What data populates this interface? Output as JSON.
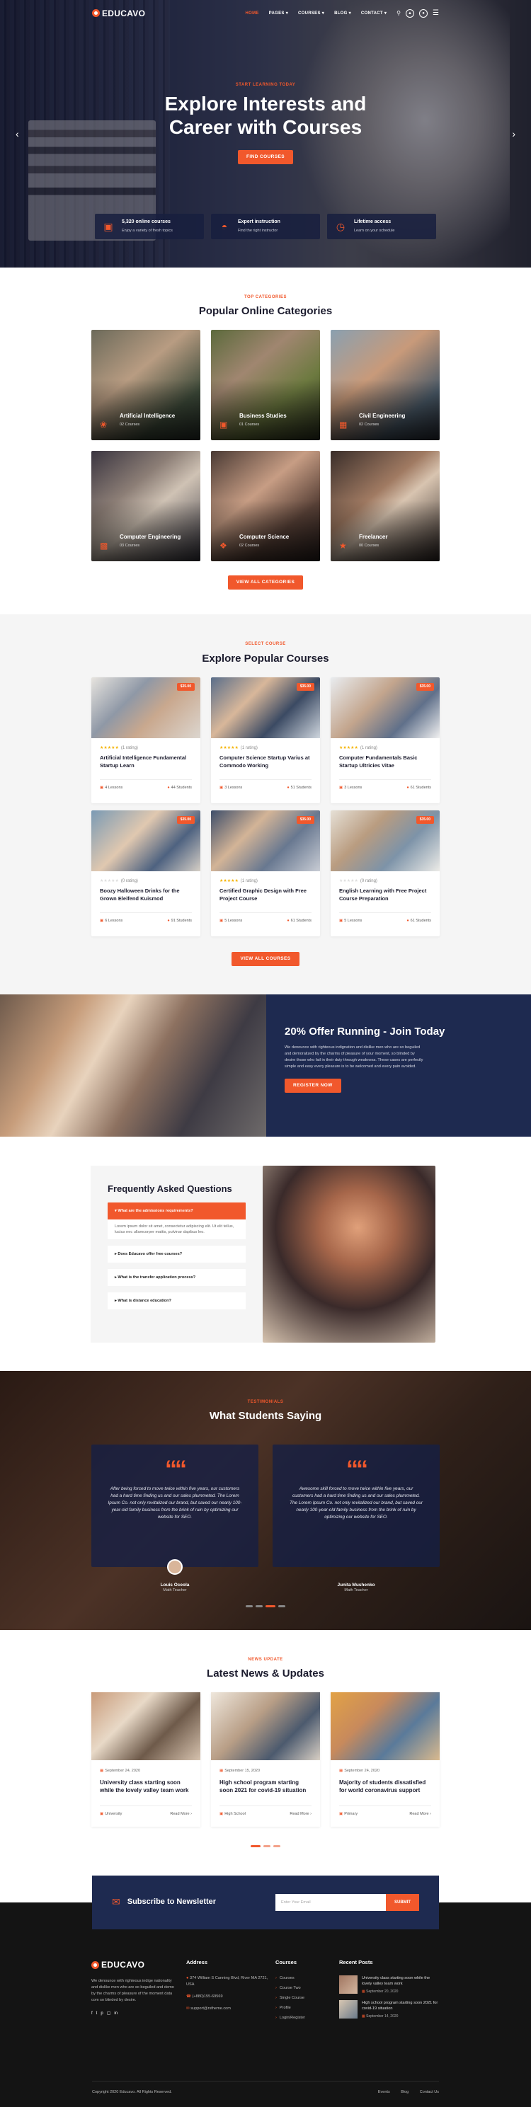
{
  "nav": {
    "brand": "EDUCAVO",
    "menu": [
      "HOME",
      "PAGES",
      "COURSES",
      "BLOG",
      "CONTACT"
    ],
    "active": "HOME"
  },
  "hero": {
    "kicker": "START LEARNING TODAY",
    "title_line1": "Explore Interests and",
    "title_line2": "Career with Courses",
    "button": "FIND COURSES",
    "features": [
      {
        "title": "5,320 online courses",
        "text": "Enjoy a variety of fresh topics",
        "icon": "monitor-icon"
      },
      {
        "title": "Expert instruction",
        "text": "Find the right instructor",
        "icon": "instructor-icon"
      },
      {
        "title": "Lifetime access",
        "text": "Learn on your schedule",
        "icon": "clock-icon"
      }
    ]
  },
  "categories": {
    "kicker": "TOP CATEGORIES",
    "title": "Popular Online Categories",
    "items": [
      {
        "name": "Artificial Intelligence",
        "count": "02 Courses"
      },
      {
        "name": "Business Studies",
        "count": "01 Courses"
      },
      {
        "name": "Civil Engineering",
        "count": "02 Courses"
      },
      {
        "name": "Computer Engineering",
        "count": "03 Courses"
      },
      {
        "name": "Computer Science",
        "count": "02 Courses"
      },
      {
        "name": "Freelancer",
        "count": "00 Courses"
      }
    ],
    "button": "VIEW ALL CATEGORIES"
  },
  "courses": {
    "kicker": "SELECT COURSE",
    "title": "Explore Popular Courses",
    "items": [
      {
        "title": "Artificial Intelligence Fundamental Startup Learn",
        "rating": "(1 rating)",
        "lessons": "4 Lessons",
        "students": "44 Students",
        "price": "$35.00",
        "stars": 5
      },
      {
        "title": "Computer Science Startup Varius at Commodo Working",
        "rating": "(1 rating)",
        "lessons": "3 Lessons",
        "students": "51 Students",
        "price": "$35.00",
        "stars": 5
      },
      {
        "title": "Computer Fundamentals Basic Startup Ultricies Vitae",
        "rating": "(1 rating)",
        "lessons": "3 Lessons",
        "students": "61 Students",
        "price": "$35.00",
        "stars": 5
      },
      {
        "title": "Boozy Halloween Drinks for the Grown Eleifend Kuismod",
        "rating": "(0 rating)",
        "lessons": "6 Lessons",
        "students": "91 Students",
        "price": "$35.00",
        "stars": 0
      },
      {
        "title": "Certified Graphic Design with Free Project Course",
        "rating": "(1 rating)",
        "lessons": "5 Lessons",
        "students": "61 Students",
        "price": "$35.00",
        "stars": 5
      },
      {
        "title": "English Learning with Free Project Course Preparation",
        "rating": "(0 rating)",
        "lessons": "5 Lessons",
        "students": "61 Students",
        "price": "$35.00",
        "stars": 0
      }
    ],
    "button": "VIEW ALL COURSES"
  },
  "offer": {
    "title": "20% Offer Running - Join Today",
    "text": "We denounce with righteous indignation and dislike men who are so beguiled and demoralized by the charms of pleasure of your moment, so blinded by desire those who fail in their duty through weakness. These cases are perfectly simple and easy every pleasure is to be welcomed and every pain avoided.",
    "button": "REGISTER NOW"
  },
  "faq": {
    "title": "Frequently Asked Questions",
    "items": [
      {
        "q": "What are the admissions requirements?",
        "a": "Lorem ipsum dolor sit amet, consectetur adipiscing elit. Ut elit tellus, luctus nec ullamcorper mattis, pulvinar dapibus leo."
      },
      {
        "q": "Does Educavo offer free courses?"
      },
      {
        "q": "What is the transfer application process?"
      },
      {
        "q": "What is distance education?"
      }
    ]
  },
  "testimonials": {
    "kicker": "TESTIMONIALS",
    "title": "What Students Saying",
    "items": [
      {
        "text": "After being forced to move twice within five years, our customers had a hard time finding us and our sales plummeted. The Lorem Ipsum Co. not only revitalized our brand, but saved our nearly 100-year-old family business from the brink of ruin by optimizing our website for SEO.",
        "name": "Louis Oceola",
        "role": "Math Teacher"
      },
      {
        "text": "Awesome skill forced to move twice within five years, our customers had a hard time finding us and our sales plummeted. The Lorem Ipsum Co. not only revitalized our brand, but saved our nearly 100-year-old family business from the brink of ruin by optimizing our website for SEO.",
        "name": "Junita Mushenko",
        "role": "Math Teacher"
      }
    ]
  },
  "news": {
    "kicker": "NEWS UPDATE",
    "title": "Latest News & Updates",
    "items": [
      {
        "date": "September 24, 2020",
        "title": "University class starting soon while the lovely valley team work",
        "cat": "University",
        "more": "Read More"
      },
      {
        "date": "September 15, 2020",
        "title": "High school program starting soon 2021 for covid-19 situation",
        "cat": "High School",
        "more": "Read More"
      },
      {
        "date": "September 24, 2020",
        "title": "Majority of students dissatisfied for world coronavirus support",
        "cat": "Primary",
        "more": "Read More"
      }
    ]
  },
  "newsletter": {
    "title": "Subscribe to Newsletter",
    "placeholder": "Enter Your Email",
    "button": "SUBMIT"
  },
  "footer": {
    "about": "We denounce with righteous indige nationality and dislike men who are so beguiled and demo by the charms of pleasure of the moment data com so blinded by desire.",
    "address_title": "Address",
    "address": "374 William S Canning Blvd, River MA 2721, USA",
    "phone": "(+880)155-69569",
    "email": "support@rstheme.com",
    "courses_title": "Courses",
    "courses": [
      "Courses",
      "Course Two",
      "Single Course",
      "Profile",
      "Login/Register"
    ],
    "recent_title": "Recent Posts",
    "recent": [
      {
        "title": "University class starting soon while the lovely valley team work",
        "date": "September 20, 2020"
      },
      {
        "title": "High school program starting soon 2021 for covid-19 situation",
        "date": "September 14, 2020"
      }
    ],
    "copyright": "Copyright 2020 Educavo. All Rights Reserved.",
    "links": [
      "Events",
      "Blog",
      "Contact Us"
    ]
  }
}
